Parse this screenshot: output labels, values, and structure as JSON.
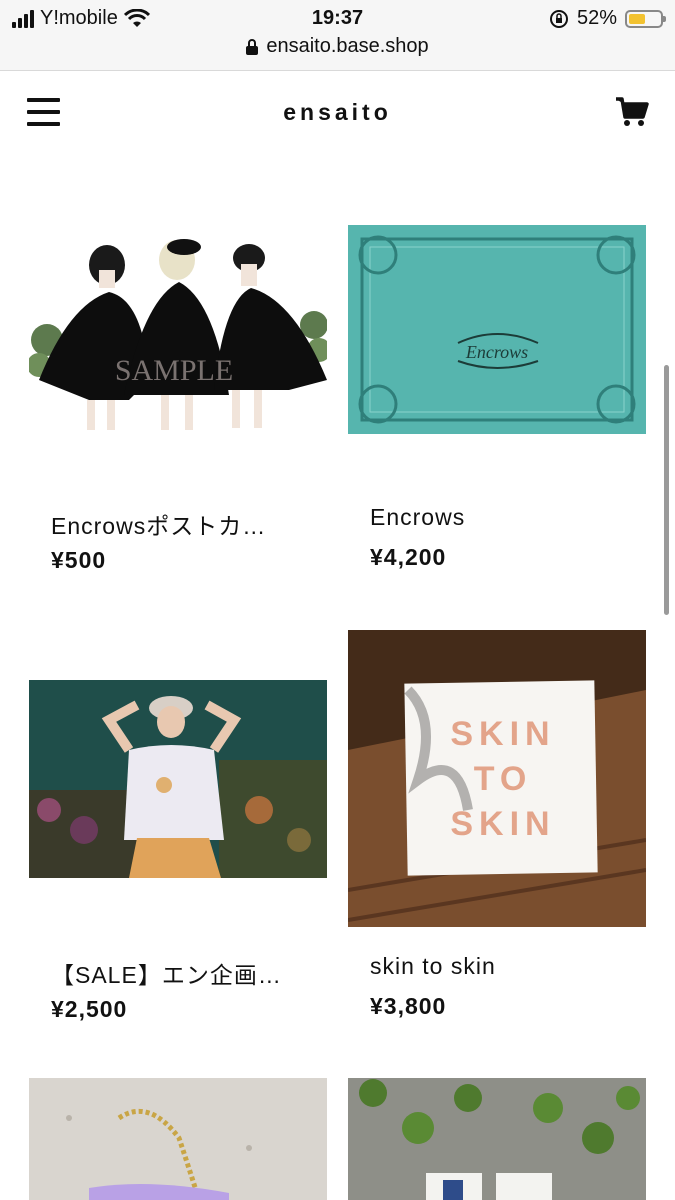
{
  "status_bar": {
    "carrier": "Y!mobile",
    "time": "19:37",
    "battery": "52%",
    "battery_level": 0.52,
    "url": "ensaito.base.shop"
  },
  "header": {
    "brand": "ensaito",
    "menu_icon": "hamburger-menu-icon",
    "cart_icon": "cart-icon"
  },
  "products": [
    {
      "title": "Encrowsポストカ…",
      "price": "¥500",
      "image_text": "SAMPLE"
    },
    {
      "title": "Encrows",
      "price": "¥4,200",
      "image_text": "Encrows"
    },
    {
      "title": "【SALE】エン企画…",
      "price": "¥2,500"
    },
    {
      "title": "skin to skin",
      "price": "¥3,800",
      "image_text": "SKIN TO SKIN"
    }
  ],
  "colors": {
    "accent": "#111111",
    "teal": "#3aa6a0"
  }
}
